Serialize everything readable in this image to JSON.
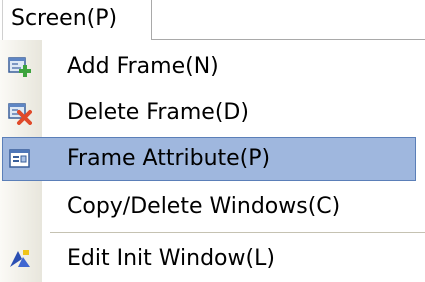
{
  "menubar": {
    "screen_menu": "Screen(P)"
  },
  "menu": {
    "items": [
      {
        "label": "Add Frame(N)",
        "icon": "add-frame-icon",
        "selected": false
      },
      {
        "label": "Delete Frame(D)",
        "icon": "delete-frame-icon",
        "selected": false
      },
      {
        "label": "Frame Attribute(P)",
        "icon": "frame-attribute-icon",
        "selected": true
      },
      {
        "label": "Copy/Delete Windows(C)",
        "icon": null,
        "selected": false
      },
      {
        "label": "Edit Init Window(L)",
        "icon": "edit-init-window-icon",
        "selected": false
      }
    ]
  },
  "colors": {
    "highlight": "#9fb7de",
    "highlight_border": "#5b7fb8"
  }
}
